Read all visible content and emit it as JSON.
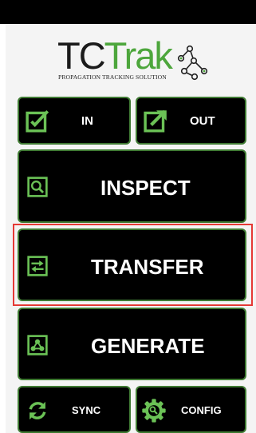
{
  "logo": {
    "tc": "TC",
    "trak": "Trak",
    "tagline": "PROPAGATION TRACKING SOLUTION"
  },
  "buttons": {
    "in": {
      "label": "IN",
      "icon": "checkin-icon"
    },
    "out": {
      "label": "OUT",
      "icon": "checkout-icon"
    },
    "inspect": {
      "label": "INSPECT",
      "icon": "inspect-icon"
    },
    "transfer": {
      "label": "TRANSFER",
      "icon": "transfer-icon",
      "selected": true
    },
    "generate": {
      "label": "GENERATE",
      "icon": "generate-icon"
    },
    "sync": {
      "label": "SYNC",
      "icon": "sync-icon"
    },
    "config": {
      "label": "CONFIG",
      "icon": "config-icon"
    }
  },
  "colors": {
    "accent_green": "#6bc256",
    "button_border": "#3f7a33",
    "button_bg": "#000000",
    "selection_outline": "#e53935",
    "logo_green": "#4da63c"
  }
}
